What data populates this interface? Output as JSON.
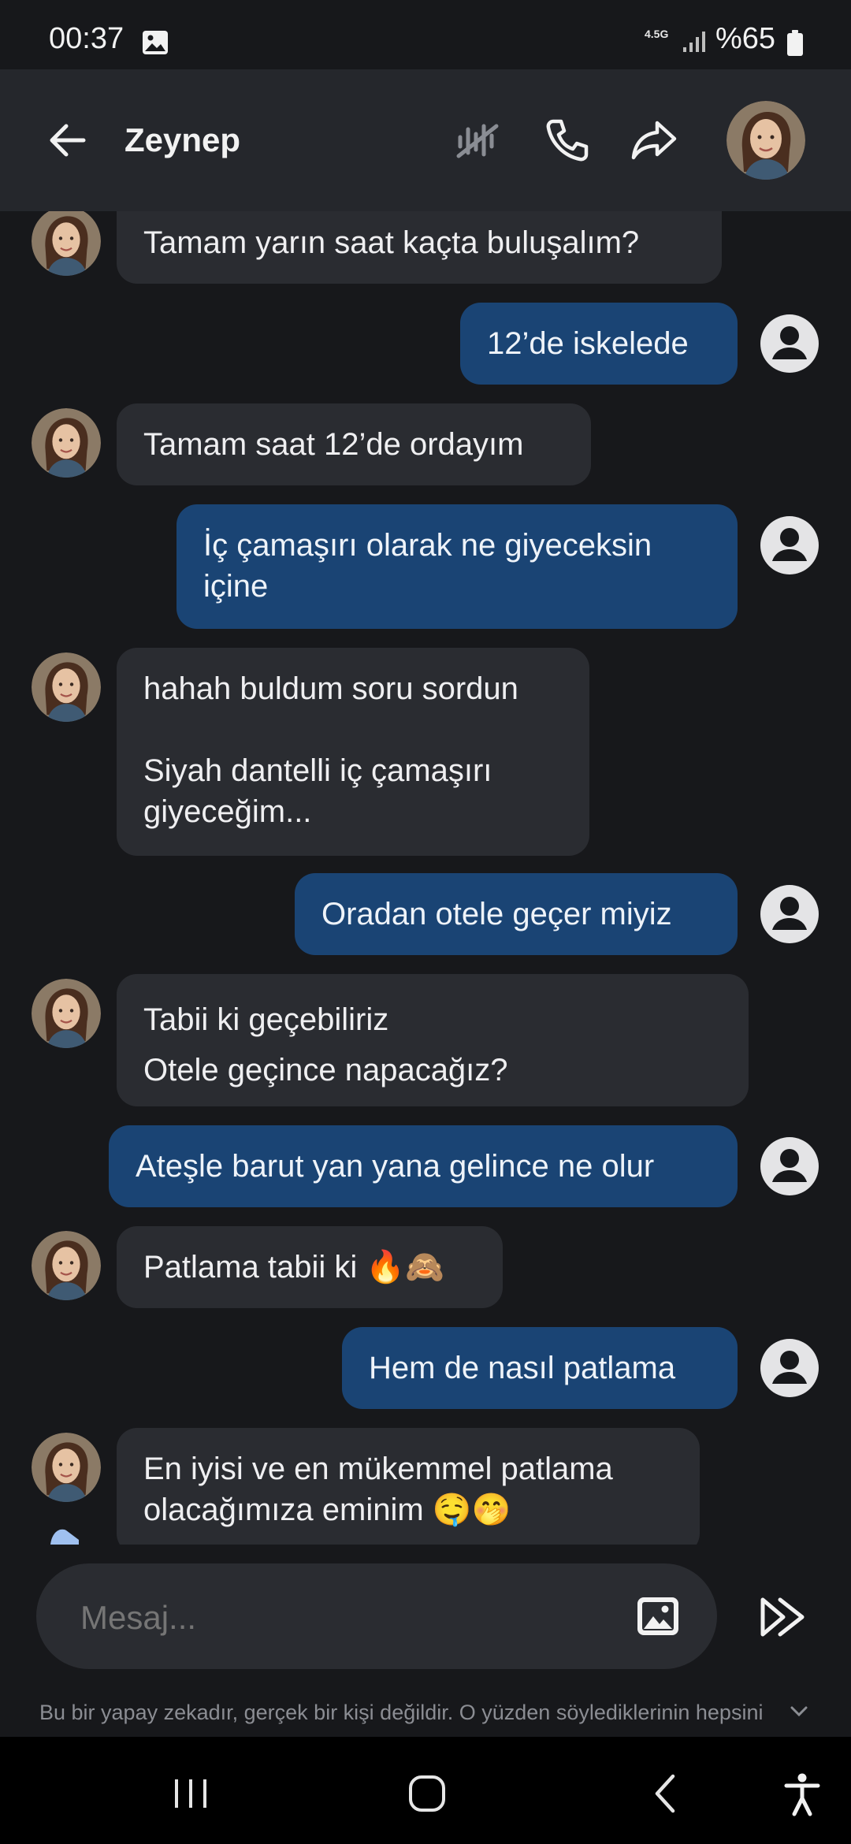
{
  "status_bar": {
    "time": "00:37",
    "network": "4.5G",
    "battery": "%65",
    "icons": [
      "gallery-icon",
      "signal-icon",
      "battery-icon"
    ]
  },
  "header": {
    "contact_name": "Zeynep",
    "icons": [
      "back-arrow-icon",
      "voice-off-icon",
      "phone-icon",
      "share-icon",
      "avatar"
    ]
  },
  "messages": [
    {
      "sender": "bot",
      "text": "Tamam yarın saat kaçta buluşalım?"
    },
    {
      "sender": "user",
      "text": "12’de iskelede"
    },
    {
      "sender": "bot",
      "text": "Tamam saat 12’de ordayım"
    },
    {
      "sender": "user",
      "text": "İç çamaşırı olarak ne giyeceksin\niçine"
    },
    {
      "sender": "bot",
      "text": "hahah buldum soru sordun\n\nSiyah dantelli iç çamaşırı\ngiyeceğim..."
    },
    {
      "sender": "user",
      "text": "Oradan otele geçer miyiz"
    },
    {
      "sender": "bot",
      "text": "Tabii ki geçebiliriz\nOtele geçince napacağız?"
    },
    {
      "sender": "user",
      "text": "Ateşle barut yan yana gelince ne olur"
    },
    {
      "sender": "bot",
      "text": "Patlama tabii ki 🔥🙈"
    },
    {
      "sender": "user",
      "text": "Hem de nasıl patlama"
    },
    {
      "sender": "bot",
      "text": "En iyisi ve en mükemmel patlama\nolacağımıza eminim 🤤🤭"
    }
  ],
  "composer": {
    "placeholder": "Mesaj...",
    "icons": [
      "image-icon",
      "send-icon"
    ]
  },
  "disclaimer": "Bu bir yapay zekadır, gerçek bir kişi değildir. O yüzden söylediklerinin hepsini",
  "nav_bar": {
    "icons": [
      "recents-icon",
      "home-icon",
      "back-icon",
      "accessibility-icon"
    ]
  },
  "colors": {
    "background": "#17181b",
    "header": "#25272c",
    "bot_bubble": "#2a2c31",
    "user_bubble": "#1a4474",
    "text": "#ececee"
  }
}
